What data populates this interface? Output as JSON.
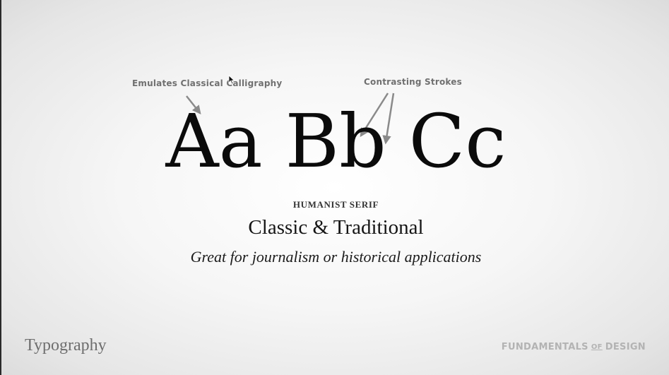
{
  "annotations": {
    "left": "Emulates Classical Calligraphy",
    "right": "Contrasting Strokes"
  },
  "specimen": {
    "a": "Aa",
    "b": "Bb",
    "c": "Cc"
  },
  "category": "HUMANIST SERIF",
  "subtitle": "Classic & Traditional",
  "description": "Great for journalism or historical applications",
  "footer": {
    "section": "Typography",
    "brand_part1": "FUNDAMENTALS",
    "brand_of": "OF",
    "brand_part2": "DESIGN"
  },
  "colors": {
    "annotation": "#707070",
    "arrow": "#8a8a8a",
    "brand": "#b3b3b3"
  }
}
